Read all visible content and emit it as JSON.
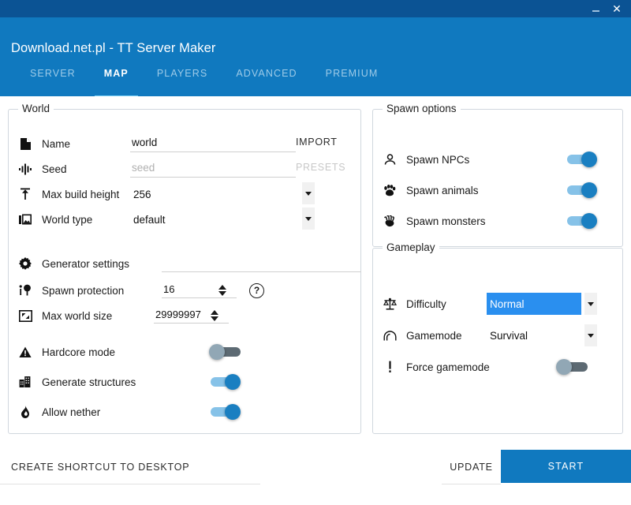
{
  "window": {
    "title": "Download.net.pl - TT Server Maker",
    "minimize_label": "–",
    "close_label": "✕"
  },
  "tabs": [
    {
      "label": "SERVER",
      "active": false
    },
    {
      "label": "MAP",
      "active": true
    },
    {
      "label": "PLAYERS",
      "active": false
    },
    {
      "label": "ADVANCED",
      "active": false
    },
    {
      "label": "PREMIUM",
      "active": false
    }
  ],
  "world": {
    "legend": "World",
    "name": {
      "icon": "file-icon",
      "label": "Name",
      "value": "world"
    },
    "seed": {
      "icon": "waveform-icon",
      "label": "Seed",
      "value": "",
      "placeholder": "seed"
    },
    "max_build_height": {
      "icon": "height-arrow-icon",
      "label": "Max build height",
      "value": "256"
    },
    "world_type": {
      "icon": "image-stack-icon",
      "label": "World type",
      "value": "default"
    },
    "generator_settings": {
      "icon": "gear-icon",
      "label": "Generator settings",
      "value": ""
    },
    "spawn_protection": {
      "icon": "tree-spawn-icon",
      "label": "Spawn protection",
      "value": "16",
      "help": "?"
    },
    "max_world_size": {
      "icon": "resize-icon",
      "label": "Max world size",
      "value": "29999997"
    },
    "hardcore_mode": {
      "icon": "warning-triangle-icon",
      "label": "Hardcore mode",
      "on": false
    },
    "generate_structures": {
      "icon": "building-icon",
      "label": "Generate structures",
      "on": true
    },
    "allow_nether": {
      "icon": "flame-icon",
      "label": "Allow nether",
      "on": true
    },
    "import_label": "IMPORT",
    "presets_label": "PRESETS"
  },
  "spawn_options": {
    "legend": "Spawn options",
    "items": [
      {
        "icon": "person-icon",
        "label": "Spawn NPCs",
        "on": true
      },
      {
        "icon": "paw-icon",
        "label": "Spawn animals",
        "on": true
      },
      {
        "icon": "claw-icon",
        "label": "Spawn monsters",
        "on": true
      }
    ]
  },
  "gameplay": {
    "legend": "Gameplay",
    "difficulty": {
      "icon": "scales-icon",
      "label": "Difficulty",
      "value": "Normal"
    },
    "gamemode": {
      "icon": "arch-icon",
      "label": "Gamemode",
      "value": "Survival"
    },
    "force_gamemode": {
      "icon": "exclamation-icon",
      "label": "Force gamemode",
      "on": false
    }
  },
  "footer": {
    "shortcut_label": "CREATE SHORTCUT TO DESKTOP",
    "update_label": "UPDATE",
    "start_label": "START"
  },
  "colors": {
    "titlebar": "#0b5394",
    "header": "#1079bf",
    "tab_active_underline": "#7fd3f7",
    "toggle_on_thumb": "#1a7fc1",
    "toggle_on_track": "#86c2e8",
    "toggle_off_thumb": "#91a7b5",
    "toggle_off_track": "#5d6a73",
    "selection_highlight": "#2a8fef",
    "start_button": "#1079bf"
  }
}
